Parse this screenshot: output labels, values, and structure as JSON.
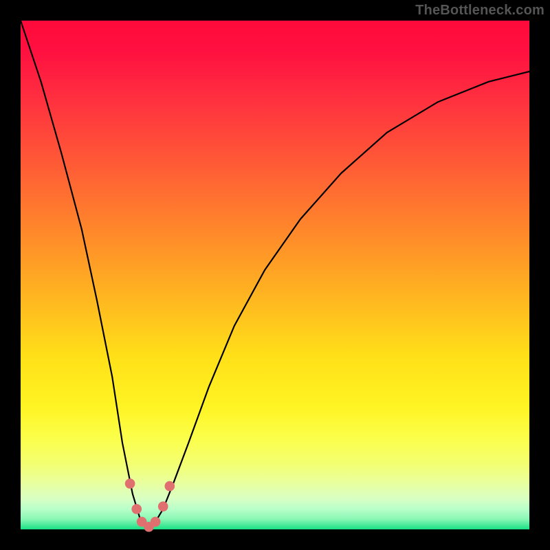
{
  "watermark": "TheBottleneck.com",
  "colors": {
    "frame": "#000000",
    "curve": "#000000",
    "marker": "#e07070",
    "gradient_stops": [
      "#ff0a3a",
      "#ff1040",
      "#ff2b40",
      "#ff5a36",
      "#ff8a2a",
      "#ffb820",
      "#ffe018",
      "#fff424",
      "#fbff4a",
      "#f4ff70",
      "#e8ffa0",
      "#d8ffc4",
      "#b8ffca",
      "#88f7b4",
      "#18e084"
    ]
  },
  "chart_data": {
    "type": "line",
    "title": "",
    "xlabel": "",
    "ylabel": "",
    "xlim": [
      0,
      100
    ],
    "ylim": [
      0,
      100
    ],
    "grid": false,
    "legend": false,
    "series": [
      {
        "name": "bottleneck-curve",
        "x": [
          0,
          4,
          8,
          12,
          15,
          18,
          20,
          22,
          23.5,
          25,
          26.5,
          28,
          30,
          33,
          37,
          42,
          48,
          55,
          63,
          72,
          82,
          92,
          100
        ],
        "y": [
          100,
          88,
          74,
          59,
          45,
          30,
          17,
          7,
          2,
          0,
          1.5,
          4,
          9,
          17,
          28,
          40,
          51,
          61,
          70,
          78,
          84,
          88,
          90
        ]
      }
    ],
    "markers": [
      {
        "x": 21.5,
        "y": 9,
        "r": 1.1
      },
      {
        "x": 22.8,
        "y": 4,
        "r": 1.1
      },
      {
        "x": 23.8,
        "y": 1.5,
        "r": 1.1
      },
      {
        "x": 25.2,
        "y": 0.5,
        "r": 1.1
      },
      {
        "x": 26.5,
        "y": 1.5,
        "r": 1.1
      },
      {
        "x": 28.0,
        "y": 4.5,
        "r": 1.1
      },
      {
        "x": 29.3,
        "y": 8.5,
        "r": 1.1
      }
    ]
  }
}
